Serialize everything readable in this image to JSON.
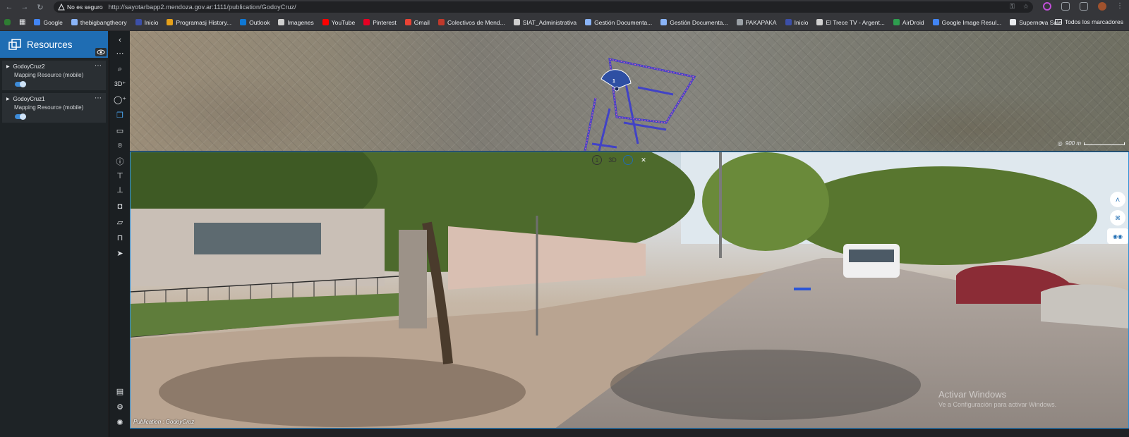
{
  "browser": {
    "security_label": "No es seguro",
    "url": "http://sayotarbapp2.mendoza.gov.ar:1111/publication/GodoyCruz/",
    "bookmarks": [
      {
        "label": "Google",
        "color": "#4285f4"
      },
      {
        "label": "thebigbangtheory",
        "color": "#8ab4f8"
      },
      {
        "label": "Inicio",
        "color": "#3c4fa8"
      },
      {
        "label": "Programasj History...",
        "color": "#e6a11a"
      },
      {
        "label": "Outlook",
        "color": "#0f78d4"
      },
      {
        "label": "Imagenes",
        "color": "#cfcfcf"
      },
      {
        "label": "YouTube",
        "color": "#ff0000"
      },
      {
        "label": "Pinterest",
        "color": "#e60023"
      },
      {
        "label": "Gmail",
        "color": "#ea4335"
      },
      {
        "label": "Colectivos de Mend...",
        "color": "#c0392b"
      },
      {
        "label": "SIAT_Administrativa",
        "color": "#cfcfcf"
      },
      {
        "label": "Gestión Documenta...",
        "color": "#8ab4f8"
      },
      {
        "label": "Gestión Documenta...",
        "color": "#8ab4f8"
      },
      {
        "label": "PAKAPAKA",
        "color": "#9aa0a6"
      },
      {
        "label": "Inicio",
        "color": "#3c4fa8"
      },
      {
        "label": "El Trece TV - Argent...",
        "color": "#d0d0d0"
      },
      {
        "label": "AirDroid",
        "color": "#2e9e4f"
      },
      {
        "label": "Google Image Resul...",
        "color": "#4285f4"
      },
      {
        "label": "Supernova Sale",
        "color": "#e8eaed"
      }
    ],
    "all_bookmarks_label": "Todos los marcadores"
  },
  "panel": {
    "title": "Resources",
    "items": [
      {
        "name": "GodoyCruz2",
        "subtitle": "Mapping Resource (mobile)"
      },
      {
        "name": "GodoyCruz1",
        "subtitle": "Mapping Resource (mobile)"
      }
    ]
  },
  "map": {
    "scale_label": "900 m",
    "marker_label": "1"
  },
  "street_view": {
    "controls": [
      "1",
      "3D",
      "○",
      "✕"
    ],
    "caption": "Publication : GodoyCruz"
  },
  "watermark": {
    "title": "Activar Windows",
    "subtitle": "Ve a Configuración para activar Windows."
  }
}
